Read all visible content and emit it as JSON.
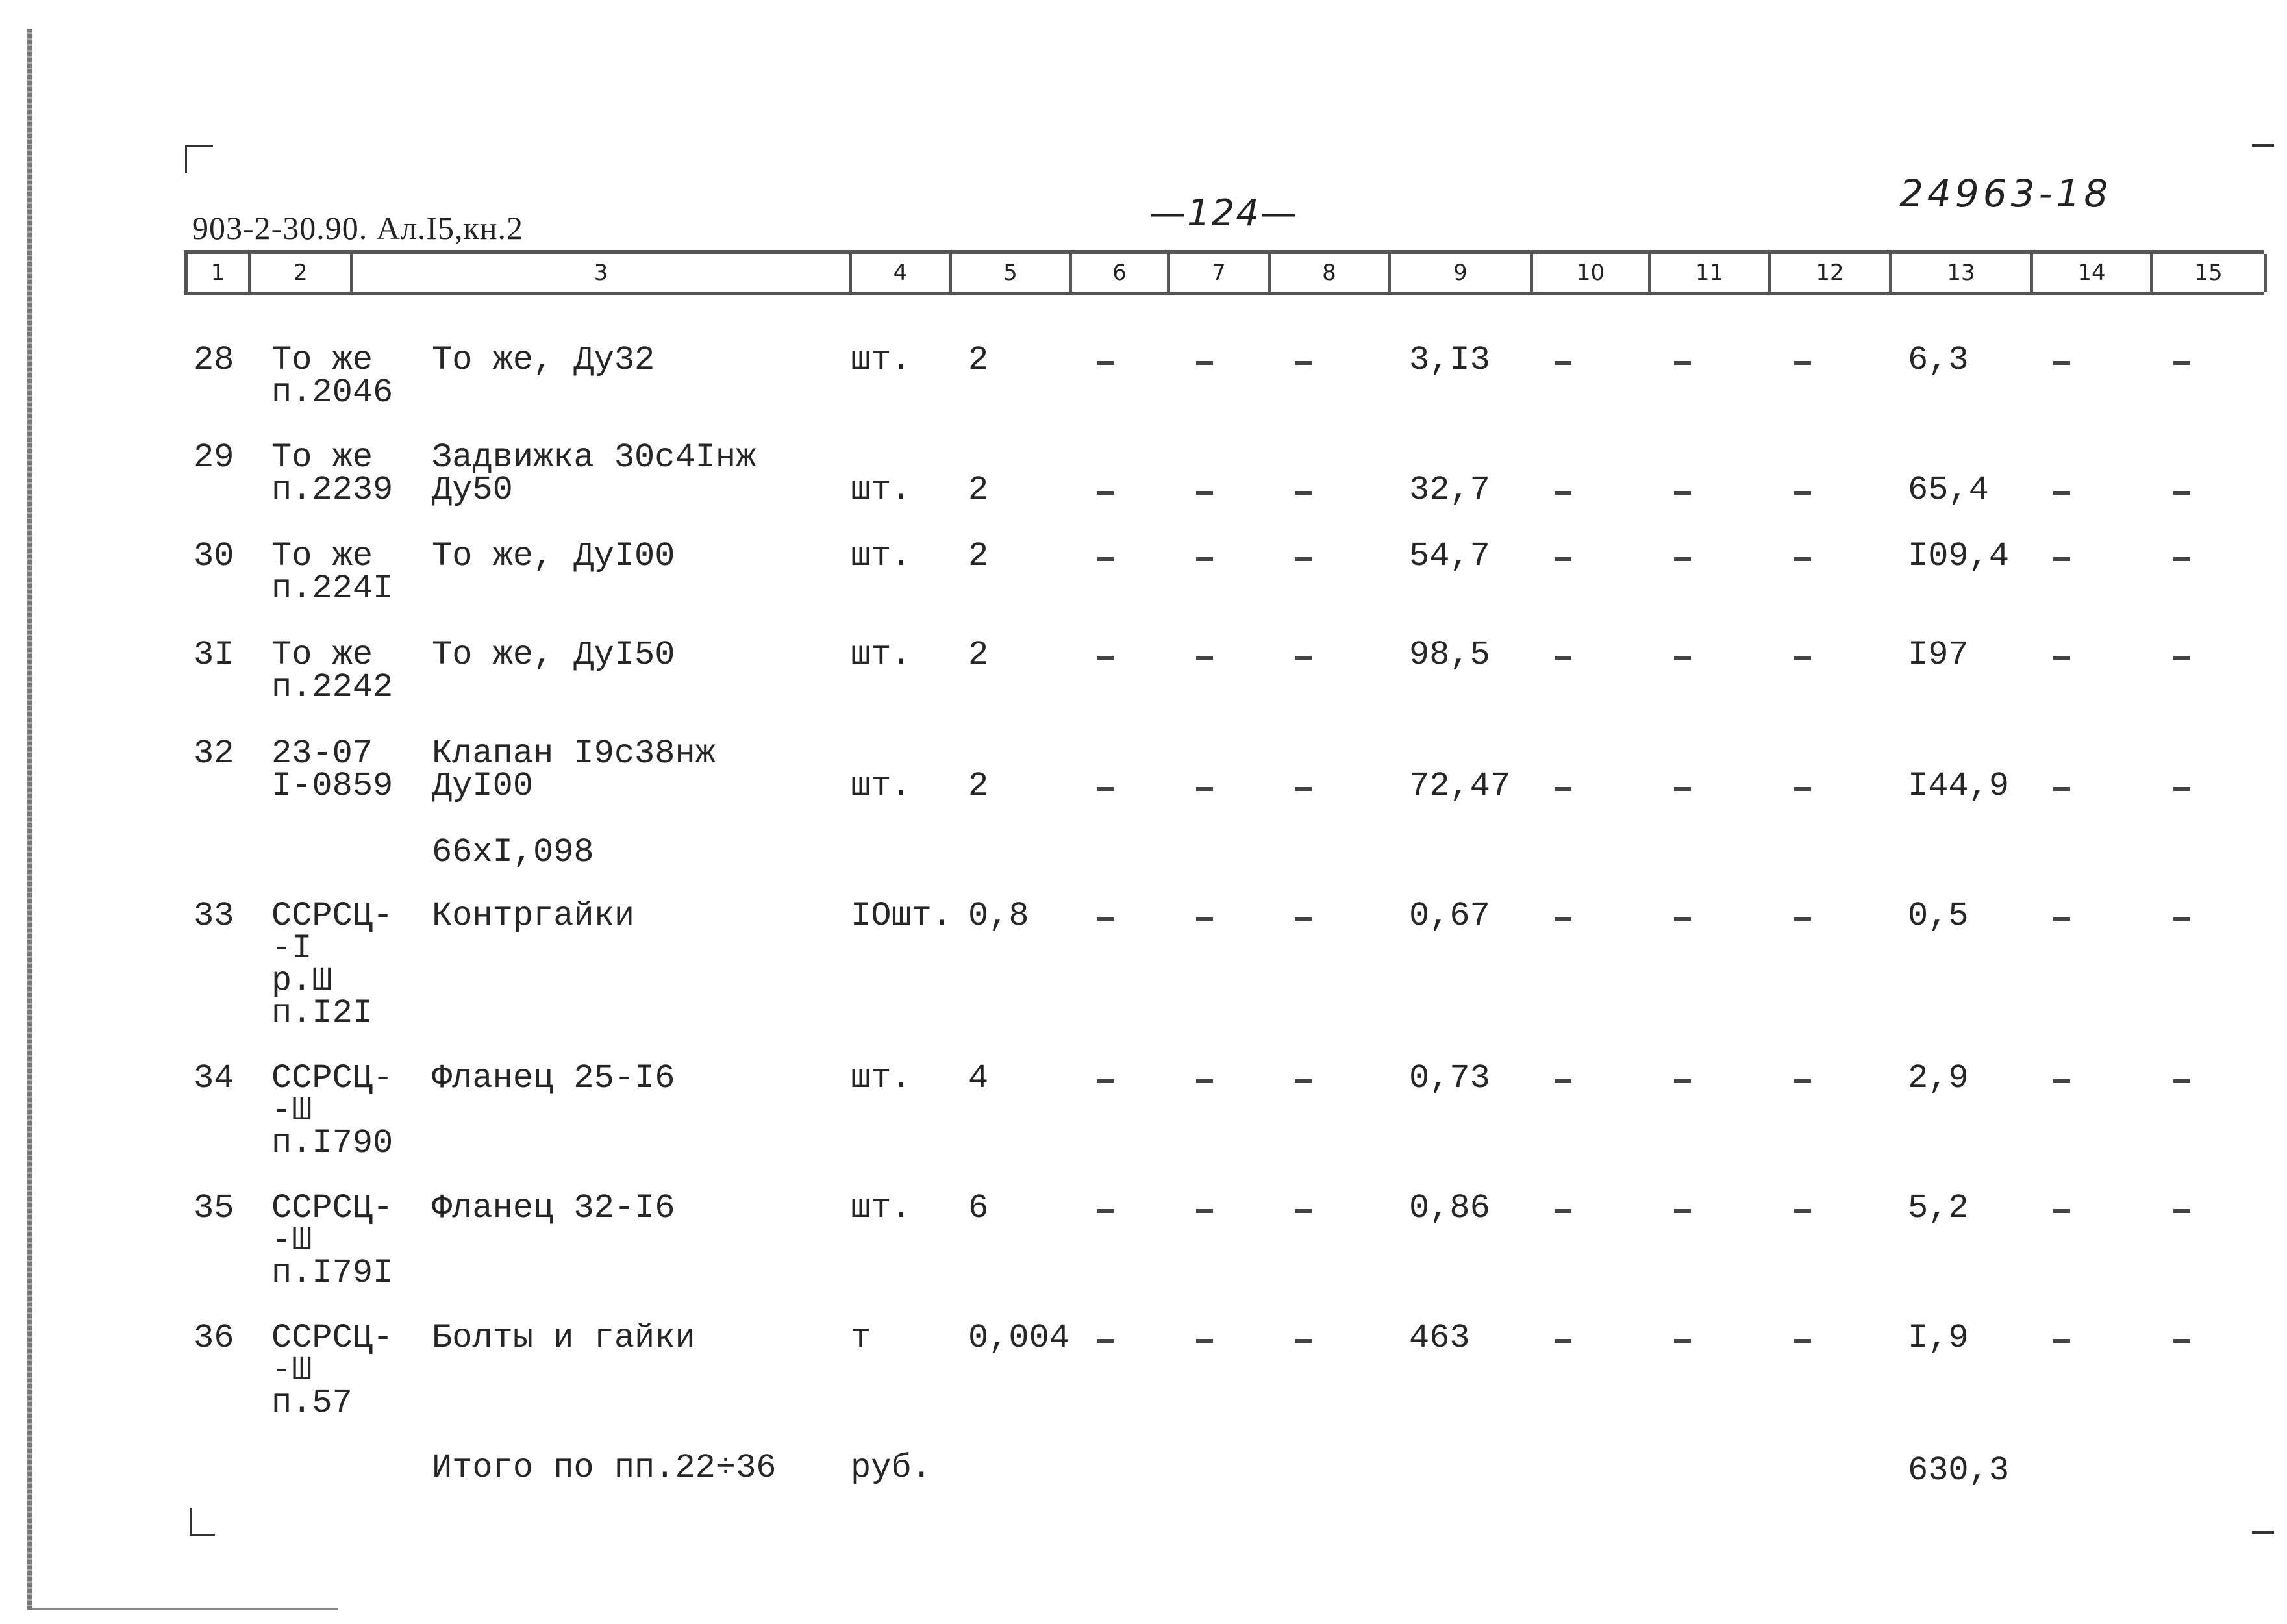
{
  "document": {
    "title": "903-2-30.90. Ал.I5,кн.2",
    "page_number": "—124—",
    "doc_number": "24963-18"
  },
  "header": {
    "columns": [
      "1",
      "2",
      "3",
      "4",
      "5",
      "6",
      "7",
      "8",
      "9",
      "10",
      "11",
      "12",
      "13",
      "14",
      "15"
    ]
  },
  "rows": [
    {
      "no": "28",
      "ref": [
        "То же",
        "п.2046"
      ],
      "desc": [
        "То же, Ду32"
      ],
      "unit": "шт.",
      "qty": "2",
      "c6": "–",
      "c7": "–",
      "c8": "–",
      "price": "3,I3",
      "c10": "–",
      "c11": "–",
      "c12": "–",
      "total": "6,3",
      "c14": "–",
      "c15": "–",
      "value_line": 0
    },
    {
      "no": "29",
      "ref": [
        "То же",
        "п.2239"
      ],
      "desc": [
        "Задвижка 30с4Iнж",
        "Ду50"
      ],
      "unit": "шт.",
      "qty": "2",
      "c6": "–",
      "c7": "–",
      "c8": "–",
      "price": "32,7",
      "c10": "–",
      "c11": "–",
      "c12": "–",
      "total": "65,4",
      "c14": "–",
      "c15": "–",
      "value_line": 1
    },
    {
      "no": "30",
      "ref": [
        "То же",
        "п.224I"
      ],
      "desc": [
        "То же, ДуI00"
      ],
      "unit": "шт.",
      "qty": "2",
      "c6": "–",
      "c7": "–",
      "c8": "–",
      "price": "54,7",
      "c10": "–",
      "c11": "–",
      "c12": "–",
      "total": "I09,4",
      "c14": "–",
      "c15": "–",
      "value_line": 0
    },
    {
      "no": "3I",
      "ref": [
        "То же",
        "п.2242"
      ],
      "desc": [
        "То же, ДуI50"
      ],
      "unit": "шт.",
      "qty": "2",
      "c6": "–",
      "c7": "–",
      "c8": "–",
      "price": "98,5",
      "c10": "–",
      "c11": "–",
      "c12": "–",
      "total": "I97",
      "c14": "–",
      "c15": "–",
      "value_line": 0
    },
    {
      "no": "32",
      "ref": [
        "23-07",
        "I-0859"
      ],
      "desc": [
        "Клапан I9с38нж",
        "ДуI00"
      ],
      "unit": "шт.",
      "qty": "2",
      "c6": "–",
      "c7": "–",
      "c8": "–",
      "price": "72,47",
      "c10": "–",
      "c11": "–",
      "c12": "–",
      "total": "I44,9",
      "c14": "–",
      "c15": "–",
      "value_line": 1
    },
    {
      "no": "",
      "ref": [],
      "desc": [
        "66хI,098"
      ],
      "unit": "",
      "qty": "",
      "c6": "",
      "c7": "",
      "c8": "",
      "price": "",
      "c10": "",
      "c11": "",
      "c12": "",
      "total": "",
      "c14": "",
      "c15": "",
      "value_line": 0
    },
    {
      "no": "33",
      "ref": [
        "ССРСЦ-",
        "-I",
        "р.Ш",
        "п.I2I"
      ],
      "desc": [
        "Контргайки"
      ],
      "unit": "IОшт.",
      "qty": "0,8",
      "c6": "–",
      "c7": "–",
      "c8": "–",
      "price": "0,67",
      "c10": "–",
      "c11": "–",
      "c12": "–",
      "total": "0,5",
      "c14": "–",
      "c15": "–",
      "value_line": 0
    },
    {
      "no": "34",
      "ref": [
        "ССРСЦ-",
        "-Ш",
        "п.I790"
      ],
      "desc": [
        "Фланец 25-I6"
      ],
      "unit": "шт.",
      "qty": "4",
      "c6": "–",
      "c7": "–",
      "c8": "–",
      "price": "0,73",
      "c10": "–",
      "c11": "–",
      "c12": "–",
      "total": "2,9",
      "c14": "–",
      "c15": "–",
      "value_line": 0
    },
    {
      "no": "35",
      "ref": [
        "ССРСЦ-",
        "-Ш",
        "п.I79I"
      ],
      "desc": [
        "Фланец 32-I6"
      ],
      "unit": "шт.",
      "qty": "6",
      "c6": "–",
      "c7": "–",
      "c8": "–",
      "price": "0,86",
      "c10": "–",
      "c11": "–",
      "c12": "–",
      "total": "5,2",
      "c14": "–",
      "c15": "–",
      "value_line": 0
    },
    {
      "no": "36",
      "ref": [
        "ССРСЦ-",
        "-Ш",
        "п.57"
      ],
      "desc": [
        "Болты и гайки"
      ],
      "unit": "т",
      "qty": "0,004",
      "c6": "–",
      "c7": "–",
      "c8": "–",
      "price": "463",
      "c10": "–",
      "c11": "–",
      "c12": "–",
      "total": "I,9",
      "c14": "–",
      "c15": "–",
      "value_line": 0
    }
  ],
  "summary": {
    "label": "Итого по пп.22÷36",
    "unit": "руб.",
    "total": "630,3"
  }
}
